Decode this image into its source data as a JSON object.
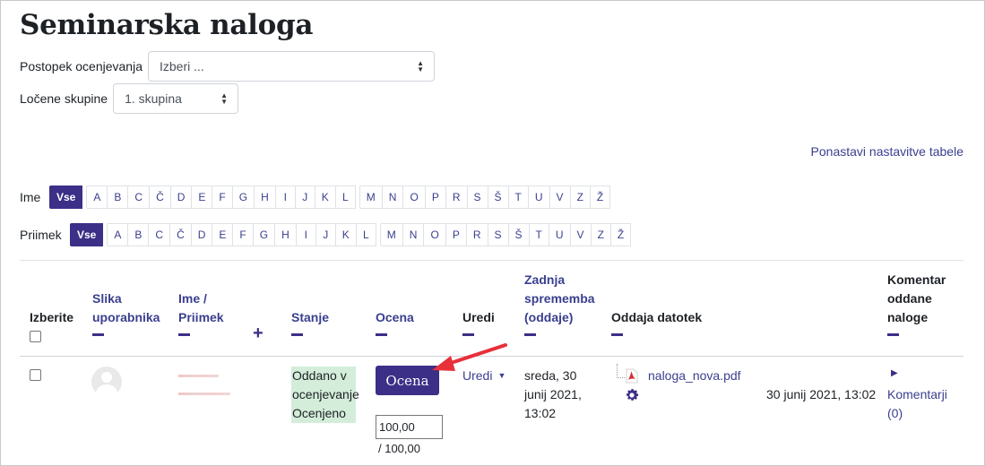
{
  "page": {
    "title": "Seminarska naloga"
  },
  "grading_method": {
    "label": "Postopek ocenjevanja",
    "value": "Izberi ..."
  },
  "separate_groups": {
    "label": "Ločene skupine",
    "value": "1. skupina"
  },
  "reset_link": "Ponastavi nastavitve tabele",
  "first_name_filter": {
    "label": "Ime",
    "all": "Vse",
    "letters": [
      "A",
      "B",
      "C",
      "Č",
      "D",
      "E",
      "F",
      "G",
      "H",
      "I",
      "J",
      "K",
      "L",
      "M",
      "N",
      "O",
      "P",
      "R",
      "S",
      "Š",
      "T",
      "U",
      "V",
      "Z",
      "Ž"
    ]
  },
  "last_name_filter": {
    "label": "Priimek",
    "all": "Vse",
    "letters": [
      "A",
      "B",
      "C",
      "Č",
      "D",
      "E",
      "F",
      "G",
      "H",
      "I",
      "J",
      "K",
      "L",
      "M",
      "N",
      "O",
      "P",
      "R",
      "S",
      "Š",
      "T",
      "U",
      "V",
      "Z",
      "Ž"
    ]
  },
  "table": {
    "headers": {
      "select": "Izberite",
      "picture": [
        "Slika",
        "uporabnika"
      ],
      "name": [
        "Ime /",
        "Priimek"
      ],
      "status": "Stanje",
      "grade": "Ocena",
      "edit": "Uredi",
      "last_modified": [
        "Zadnja",
        "sprememba",
        "(oddaje)"
      ],
      "file_submissions": "Oddaja datotek",
      "comments": [
        "Komentar",
        "oddane",
        "naloge"
      ]
    },
    "row": {
      "status_lines": [
        "Oddano v",
        "ocenjevanje",
        "Ocenjeno"
      ],
      "grade_button": "Ocena",
      "grade_value": "100,00",
      "grade_max": "/ 100,00",
      "edit_label": "Uredi",
      "last_modified_lines": [
        "sreda, 30",
        "junij 2021,",
        "13:02"
      ],
      "file_name": "naloga_nova.pdf",
      "file_date": "30 junij 2021, 13:02",
      "comments_label": "Komentarji",
      "comments_count": "(0)"
    }
  },
  "colors": {
    "primary": "#3b2f87",
    "link": "#3a3f8f",
    "status_bg": "#d4edda",
    "annotation_arrow": "#e8303a"
  }
}
